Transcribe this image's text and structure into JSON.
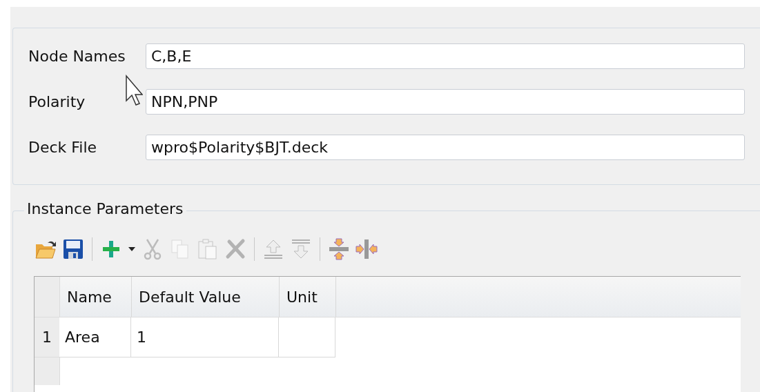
{
  "fields": [
    {
      "label": "Node Names",
      "value": "C,B,E"
    },
    {
      "label": "Polarity",
      "value": "NPN,PNP"
    },
    {
      "label": "Deck File",
      "value": "wpro$Polarity$BJT.deck"
    }
  ],
  "instance_parameters": {
    "title": "Instance Parameters",
    "toolbar": [
      {
        "kind": "open",
        "disabled": false
      },
      {
        "kind": "save",
        "disabled": false
      },
      {
        "kind": "separator"
      },
      {
        "kind": "add",
        "disabled": false
      },
      {
        "kind": "dropdown",
        "disabled": false
      },
      {
        "kind": "cut",
        "disabled": true
      },
      {
        "kind": "copy",
        "disabled": true
      },
      {
        "kind": "paste",
        "disabled": true
      },
      {
        "kind": "delete",
        "disabled": true
      },
      {
        "kind": "separator"
      },
      {
        "kind": "move_up",
        "disabled": true
      },
      {
        "kind": "move_down",
        "disabled": true
      },
      {
        "kind": "separator"
      },
      {
        "kind": "collapse",
        "disabled": false
      },
      {
        "kind": "expand",
        "disabled": false
      }
    ],
    "table": {
      "columns": [
        "Name",
        "Default Value",
        "Unit"
      ],
      "rows": [
        {
          "number": "1",
          "cells": [
            "Area",
            "1",
            ""
          ]
        }
      ]
    }
  }
}
